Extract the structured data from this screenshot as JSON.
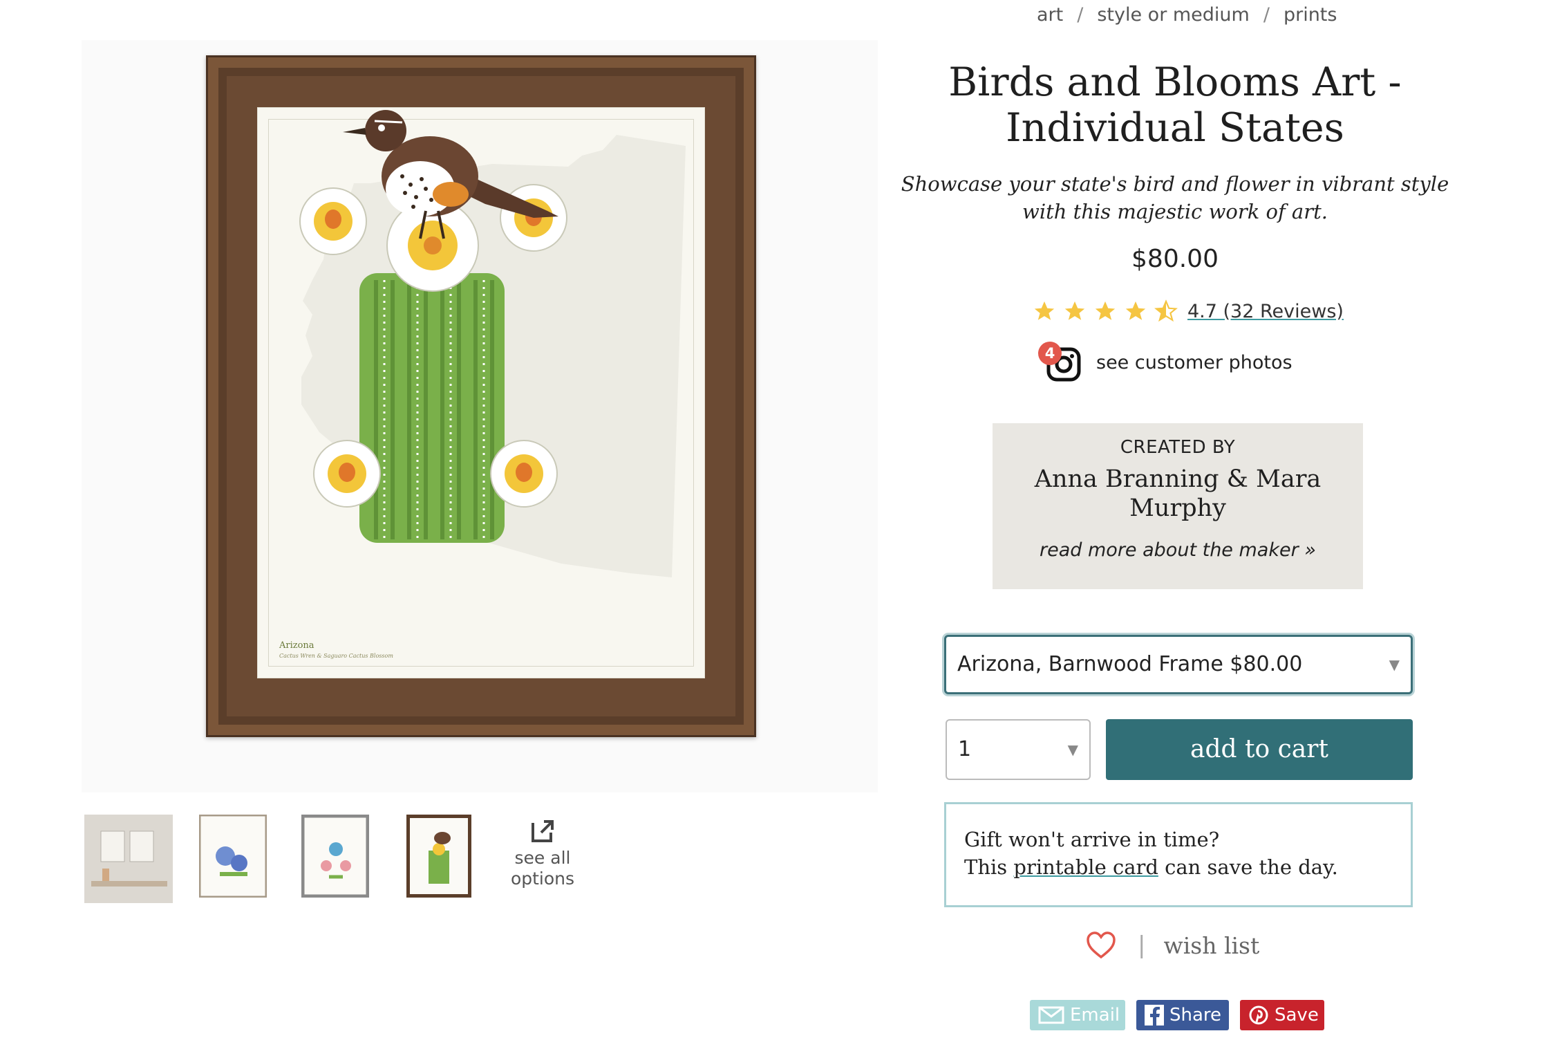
{
  "breadcrumb": [
    "art",
    "style or medium",
    "prints"
  ],
  "breadcrumb_sep": "/",
  "product": {
    "title": "Birds and Blooms Art - Individual States",
    "subtitle": "Showcase your state's bird and flower in vibrant style with this majestic work of art.",
    "price": "$80.00",
    "rating_text": "4.7 (32 Reviews)",
    "rating_value": 4.7,
    "rating_max": 5,
    "photos_badge": "4",
    "photos_label": "see customer photos"
  },
  "artwork": {
    "caption": "Arizona",
    "caption_sub": "Cactus Wren & Saguaro Cactus Blossom"
  },
  "thumbnails": {
    "see_all_line1": "see all",
    "see_all_line2": "options"
  },
  "maker": {
    "heading": "CREATED BY",
    "name": "Anna Branning & Mara Murphy",
    "link": "read more about the maker"
  },
  "purchase": {
    "variant_selected": "Arizona, Barnwood Frame $80.00",
    "quantity_selected": "1",
    "add_to_cart_label": "add to cart"
  },
  "gift": {
    "line1": "Gift won't arrive in time?",
    "line2_pre": "This ",
    "line2_link": "printable card",
    "line2_post": " can save the day."
  },
  "wishlist": {
    "sep": "|",
    "label": "wish list"
  },
  "share": {
    "email": "Email",
    "facebook": "Share",
    "pinterest": "Save"
  },
  "colors": {
    "accent_teal": "#316f77",
    "star": "#f5c542",
    "badge": "#e2574c",
    "facebook": "#3b5998",
    "pinterest": "#c8232c",
    "email": "#a9d9d9"
  },
  "icons": [
    "instagram-icon",
    "star-icon",
    "heart-icon",
    "external-link-icon",
    "mail-icon",
    "facebook-icon",
    "pinterest-icon",
    "double-chevron-right-icon",
    "caret-down-icon"
  ]
}
